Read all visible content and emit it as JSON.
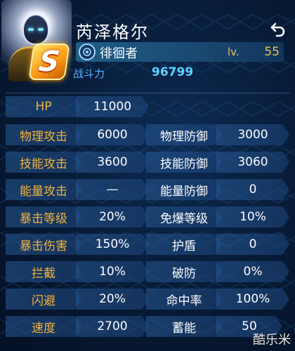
{
  "hero": {
    "name": "芮泽格尔",
    "rank": "S",
    "class_name": "徘徊者",
    "level_label": "lv.",
    "level_value": "55",
    "power_label": "战斗力",
    "power_value": "96799"
  },
  "stats": {
    "hp": {
      "label": "HP",
      "value": "11000"
    },
    "rows": [
      {
        "l_label": "物理攻击",
        "l_value": "6000",
        "r_label": "物理防御",
        "r_value": "3000"
      },
      {
        "l_label": "技能攻击",
        "l_value": "3600",
        "r_label": "技能防御",
        "r_value": "3060"
      },
      {
        "l_label": "能量攻击",
        "l_value": "—",
        "r_label": "能量防御",
        "r_value": "0"
      },
      {
        "l_label": "暴击等级",
        "l_value": "20%",
        "r_label": "免爆等级",
        "r_value": "10%"
      },
      {
        "l_label": "暴击伤害",
        "l_value": "150%",
        "r_label": "护盾",
        "r_value": "0"
      },
      {
        "l_label": "拦截",
        "l_value": "10%",
        "r_label": "破防",
        "r_value": "0%"
      },
      {
        "l_label": "闪避",
        "l_value": "20%",
        "r_label": "命中率",
        "r_value": "100%"
      },
      {
        "l_label": "速度",
        "l_value": "2700",
        "r_label": "蓄能",
        "r_value": "50"
      }
    ]
  },
  "watermark": "酷乐米",
  "colors": {
    "label_orange": "#f2b33d",
    "power_blue": "#5cd2ff",
    "level_gold": "#f0c44d",
    "rank_orange": "#ff9e1a"
  },
  "icons": {
    "back": "return-arrow-icon",
    "class": "class-emblem-icon"
  }
}
